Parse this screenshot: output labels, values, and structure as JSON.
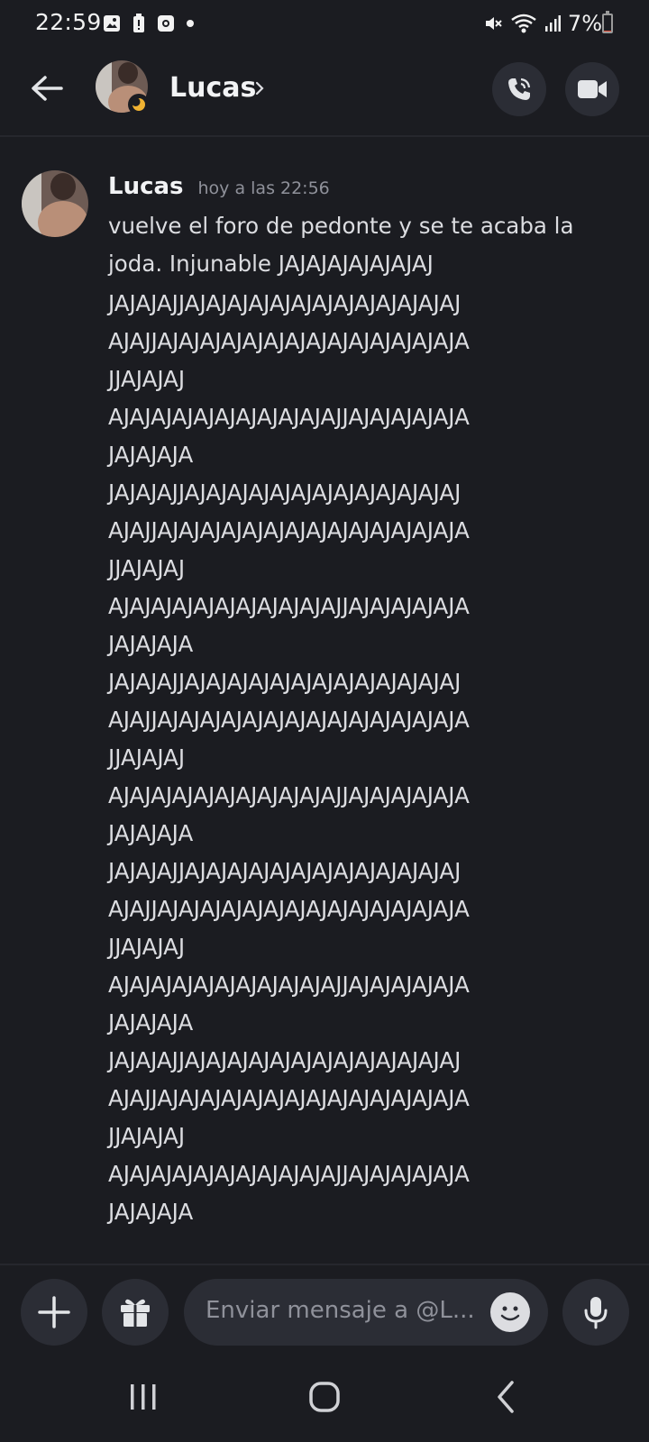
{
  "status_bar": {
    "time": "22:59",
    "battery_percent": "7%",
    "battery_level": 0.07,
    "left_icons": [
      "gallery-icon",
      "battery-alert-icon",
      "record-icon",
      "dot-icon"
    ],
    "right_icons": [
      "mute-icon",
      "wifi-icon",
      "signal-icon"
    ]
  },
  "header": {
    "contact_name": "Lucas",
    "status": "idle-moon",
    "icons": [
      "back-arrow-icon",
      "chevron-right-icon",
      "phone-call-icon",
      "video-camera-icon"
    ]
  },
  "message": {
    "author": "Lucas",
    "timestamp": "hoy a las 22:56",
    "text_lines": [
      "vuelve el foro de pedonte y se te acaba la",
      "joda. Injunable JAJAJAJAJAJAJAJ"
    ],
    "laugh_lines": [
      "JAJAJAJJAJAJAJAJAJAJAJAJAJAJAJAJAJ",
      "AJAJJAJAJAJAJAJAJAJAJAJAJAJAJAJAJA",
      "JJAJAJAJ",
      "AJAJAJAJAJAJAJAJAJAJAJJAJAJAJAJAJA",
      "JAJAJAJA",
      "JAJAJAJJAJAJAJAJAJAJAJAJAJAJAJAJAJ",
      "AJAJJAJAJAJAJAJAJAJAJAJAJAJAJAJAJA",
      "JJAJAJAJ",
      "AJAJAJAJAJAJAJAJAJAJAJJAJAJAJAJAJA",
      "JAJAJAJA",
      "JAJAJAJJAJAJAJAJAJAJAJAJAJAJAJAJAJ",
      "AJAJJAJAJAJAJAJAJAJAJAJAJAJAJAJAJA",
      "JJAJAJAJ",
      "AJAJAJAJAJAJAJAJAJAJAJJAJAJAJAJAJA",
      "JAJAJAJA",
      "JAJAJAJJAJAJAJAJAJAJAJAJAJAJAJAJAJ",
      "AJAJJAJAJAJAJAJAJAJAJAJAJAJAJAJAJA",
      "JJAJAJAJ",
      "AJAJAJAJAJAJAJAJAJAJAJJAJAJAJAJAJA",
      "JAJAJAJA",
      "JAJAJAJJAJAJAJAJAJAJAJAJAJAJAJAJAJ",
      "AJAJJAJAJAJAJAJAJAJAJAJAJAJAJAJAJA",
      "JJAJAJAJ",
      "AJAJAJAJAJAJAJAJAJAJAJJAJAJAJAJAJA",
      "JAJAJAJA"
    ]
  },
  "composer": {
    "placeholder": "Enviar mensaje a @L...",
    "icons": [
      "plus-icon",
      "gift-icon",
      "emoji-icon",
      "microphone-icon"
    ]
  },
  "nav_bar": {
    "icons": [
      "recents-icon",
      "home-icon",
      "back-icon"
    ]
  },
  "colors": {
    "background": "#1b1c21",
    "button_bg": "#2b2d35",
    "text_primary": "#dcdde1",
    "text_muted": "#8f919a",
    "status_idle": "#f0b232",
    "battery_low": "#e5533d"
  }
}
